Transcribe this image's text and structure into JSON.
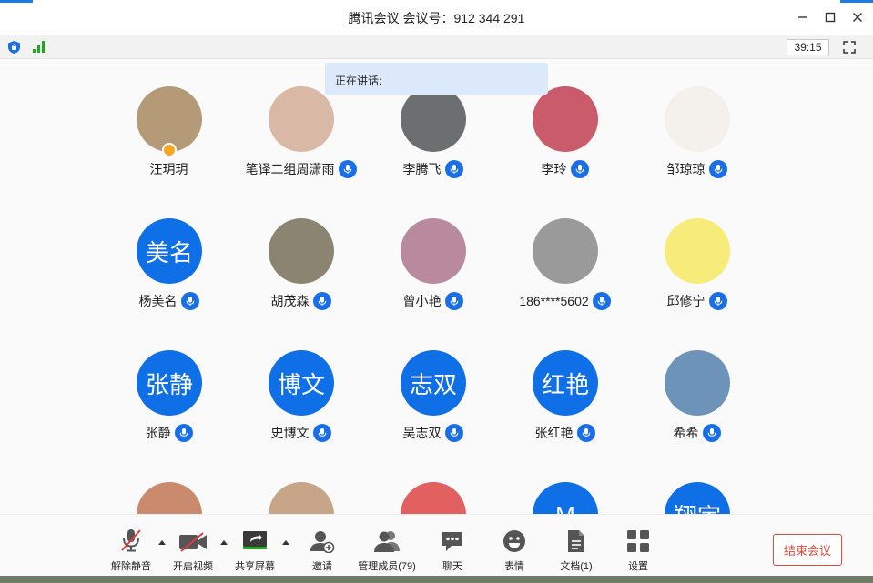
{
  "window": {
    "title": "腾讯会议 会议号：912 344 291"
  },
  "status": {
    "timer": "39:15"
  },
  "speaking": {
    "label": "正在讲话:"
  },
  "participants": [
    {
      "name": "汪玥玥",
      "avatar_text": "",
      "avatar_color": "#b59a78",
      "mic": false,
      "host": true
    },
    {
      "name": "笔译二组周潇雨",
      "avatar_text": "",
      "avatar_color": "#d9b8a6",
      "mic": true,
      "host": false
    },
    {
      "name": "李腾飞",
      "avatar_text": "",
      "avatar_color": "#6b6f70",
      "mic": true,
      "host": false
    },
    {
      "name": "李玲",
      "avatar_text": "",
      "avatar_color": "#c95b6a",
      "mic": true,
      "host": false
    },
    {
      "name": "邹琼琼",
      "avatar_text": "",
      "avatar_color": "#f4f0ec",
      "mic": true,
      "host": false
    },
    {
      "name": "杨美名",
      "avatar_text": "美名",
      "avatar_color": "#0f6fe6",
      "mic": true,
      "host": false
    },
    {
      "name": "胡茂森",
      "avatar_text": "",
      "avatar_color": "#8a8471",
      "mic": true,
      "host": false
    },
    {
      "name": "曾小艳",
      "avatar_text": "",
      "avatar_color": "#b98a9e",
      "mic": true,
      "host": false
    },
    {
      "name": "186****5602",
      "avatar_text": "",
      "avatar_color": "#9a9a9a",
      "mic": true,
      "host": false
    },
    {
      "name": "邱修宁",
      "avatar_text": "",
      "avatar_color": "#f7ec7a",
      "mic": true,
      "host": false
    },
    {
      "name": "张静",
      "avatar_text": "张静",
      "avatar_color": "#0f6fe6",
      "mic": true,
      "host": false
    },
    {
      "name": "史博文",
      "avatar_text": "博文",
      "avatar_color": "#0f6fe6",
      "mic": true,
      "host": false
    },
    {
      "name": "吴志双",
      "avatar_text": "志双",
      "avatar_color": "#0f6fe6",
      "mic": true,
      "host": false
    },
    {
      "name": "张红艳",
      "avatar_text": "红艳",
      "avatar_color": "#0f6fe6",
      "mic": true,
      "host": false
    },
    {
      "name": "希希",
      "avatar_text": "",
      "avatar_color": "#6e93b8",
      "mic": true,
      "host": false
    },
    {
      "name": "",
      "avatar_text": "",
      "avatar_color": "#c98a6e",
      "mic": false,
      "host": false
    },
    {
      "name": "",
      "avatar_text": "",
      "avatar_color": "#c7a589",
      "mic": false,
      "host": false
    },
    {
      "name": "",
      "avatar_text": "",
      "avatar_color": "#e26060",
      "mic": false,
      "host": false
    },
    {
      "name": "",
      "avatar_text": "M",
      "avatar_color": "#0f6fe6",
      "mic": false,
      "host": false
    },
    {
      "name": "",
      "avatar_text": "翔宇",
      "avatar_color": "#0f6fe6",
      "mic": false,
      "host": false
    }
  ],
  "toolbar": {
    "unmute": "解除静音",
    "start_video": "开启视频",
    "share_screen": "共享屏幕",
    "invite": "邀请",
    "manage_members": "管理成员(79)",
    "chat": "聊天",
    "reactions": "表情",
    "docs": "文档(1)",
    "settings": "设置",
    "end_meeting": "结束会议"
  },
  "colors": {
    "accent": "#1a6fe6",
    "danger": "#e04a3b",
    "signal": "#1aad19"
  }
}
